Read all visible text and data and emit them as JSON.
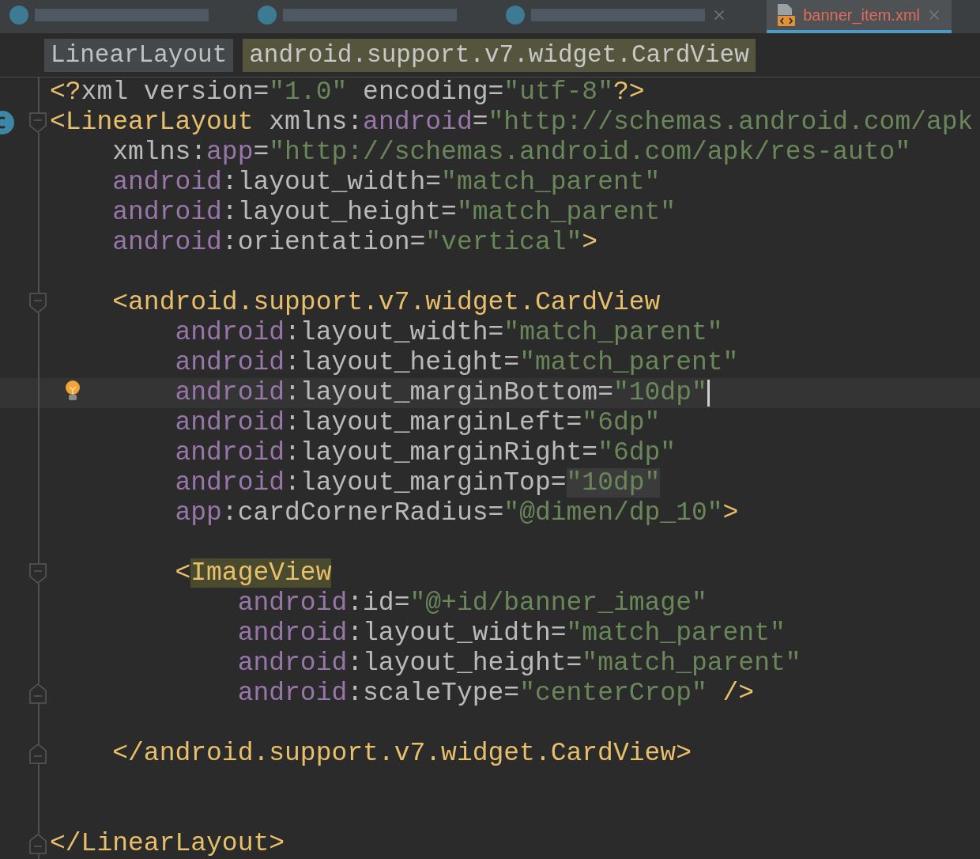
{
  "tabs": [
    {
      "kind": "obscured",
      "selected": false,
      "closable": false
    },
    {
      "kind": "obscured",
      "selected": false,
      "closable": false
    },
    {
      "kind": "obscured",
      "selected": false,
      "closable": true
    },
    {
      "kind": "file",
      "label": "banner_item.xml",
      "selected": true,
      "closable": true
    }
  ],
  "breadcrumbs": [
    {
      "label": "LinearLayout",
      "selected": false
    },
    {
      "label": "android.support.v7.widget.CardView",
      "selected": true
    }
  ],
  "lines": [
    {
      "fold_open": false,
      "fold_close": false,
      "class_marker": false,
      "bulb": false,
      "caret": false,
      "tokens": [
        {
          "kind": "tag",
          "text": "<?"
        },
        {
          "kind": "plain",
          "text": "xml version"
        },
        {
          "kind": "punct",
          "text": "="
        },
        {
          "kind": "str",
          "text": "\"1.0\""
        },
        {
          "kind": "plain",
          "text": " encoding"
        },
        {
          "kind": "punct",
          "text": "="
        },
        {
          "kind": "str",
          "text": "\"utf-8\""
        },
        {
          "kind": "tag",
          "text": "?>"
        }
      ]
    },
    {
      "fold_open": true,
      "fold_close": false,
      "class_marker": true,
      "bulb": false,
      "caret": false,
      "tokens": [
        {
          "kind": "tag",
          "text": "<LinearLayout "
        },
        {
          "kind": "attr",
          "text": "xmlns:"
        },
        {
          "kind": "ns",
          "text": "android"
        },
        {
          "kind": "punct",
          "text": "="
        },
        {
          "kind": "str",
          "text": "\"http://schemas.android.com/apk"
        }
      ]
    },
    {
      "fold_open": false,
      "fold_close": false,
      "class_marker": false,
      "bulb": false,
      "caret": false,
      "tokens": [
        {
          "kind": "attr",
          "text": "    xmlns:"
        },
        {
          "kind": "ns",
          "text": "app"
        },
        {
          "kind": "punct",
          "text": "="
        },
        {
          "kind": "str",
          "text": "\"http://schemas.android.com/apk/res-auto\""
        }
      ]
    },
    {
      "fold_open": false,
      "fold_close": false,
      "class_marker": false,
      "bulb": false,
      "caret": false,
      "tokens": [
        {
          "kind": "ns",
          "text": "    android"
        },
        {
          "kind": "attr",
          "text": ":layout_width"
        },
        {
          "kind": "punct",
          "text": "="
        },
        {
          "kind": "str",
          "text": "\"match_parent\""
        }
      ]
    },
    {
      "fold_open": false,
      "fold_close": false,
      "class_marker": false,
      "bulb": false,
      "caret": false,
      "tokens": [
        {
          "kind": "ns",
          "text": "    android"
        },
        {
          "kind": "attr",
          "text": ":layout_height"
        },
        {
          "kind": "punct",
          "text": "="
        },
        {
          "kind": "str",
          "text": "\"match_parent\""
        }
      ]
    },
    {
      "fold_open": false,
      "fold_close": false,
      "class_marker": false,
      "bulb": false,
      "caret": false,
      "tokens": [
        {
          "kind": "ns",
          "text": "    android"
        },
        {
          "kind": "attr",
          "text": ":orientation"
        },
        {
          "kind": "punct",
          "text": "="
        },
        {
          "kind": "str",
          "text": "\"vertical\""
        },
        {
          "kind": "tag",
          "text": ">"
        }
      ]
    },
    {
      "fold_open": false,
      "fold_close": false,
      "class_marker": false,
      "bulb": false,
      "caret": false
    },
    {
      "fold_open": true,
      "fold_close": false,
      "class_marker": false,
      "bulb": false,
      "caret": false,
      "tokens": [
        {
          "kind": "tag",
          "text": "    <android.support.v7.widget.CardView"
        }
      ]
    },
    {
      "fold_open": false,
      "fold_close": false,
      "class_marker": false,
      "bulb": false,
      "caret": false,
      "tokens": [
        {
          "kind": "ns",
          "text": "        android"
        },
        {
          "kind": "attr",
          "text": ":layout_width"
        },
        {
          "kind": "punct",
          "text": "="
        },
        {
          "kind": "str",
          "text": "\"match_parent\""
        }
      ]
    },
    {
      "fold_open": false,
      "fold_close": false,
      "class_marker": false,
      "bulb": false,
      "caret": false,
      "tokens": [
        {
          "kind": "ns",
          "text": "        android"
        },
        {
          "kind": "attr",
          "text": ":layout_height"
        },
        {
          "kind": "punct",
          "text": "="
        },
        {
          "kind": "str",
          "text": "\"match_parent\""
        }
      ]
    },
    {
      "fold_open": false,
      "fold_close": false,
      "class_marker": false,
      "bulb": true,
      "caret": true,
      "tokens": [
        {
          "kind": "ns",
          "text": "        android"
        },
        {
          "kind": "attr",
          "text": ":layout_marginBottom"
        },
        {
          "kind": "punct",
          "text": "="
        },
        {
          "kind": "str",
          "text": "\"10dp\""
        }
      ]
    },
    {
      "fold_open": false,
      "fold_close": false,
      "class_marker": false,
      "bulb": false,
      "caret": false,
      "tokens": [
        {
          "kind": "ns",
          "text": "        android"
        },
        {
          "kind": "attr",
          "text": ":layout_marginLeft"
        },
        {
          "kind": "punct",
          "text": "="
        },
        {
          "kind": "str",
          "text": "\"6dp\""
        }
      ]
    },
    {
      "fold_open": false,
      "fold_close": false,
      "class_marker": false,
      "bulb": false,
      "caret": false,
      "tokens": [
        {
          "kind": "ns",
          "text": "        android"
        },
        {
          "kind": "attr",
          "text": ":layout_marginRight"
        },
        {
          "kind": "punct",
          "text": "="
        },
        {
          "kind": "str",
          "text": "\"6dp\""
        }
      ]
    },
    {
      "fold_open": false,
      "fold_close": false,
      "class_marker": false,
      "bulb": false,
      "caret": false,
      "tokens": [
        {
          "kind": "ns",
          "text": "        android"
        },
        {
          "kind": "attr",
          "text": ":layout_marginTop"
        },
        {
          "kind": "punct",
          "text": "="
        },
        {
          "kind": "str-match",
          "text": "\"10dp\""
        }
      ]
    },
    {
      "fold_open": false,
      "fold_close": false,
      "class_marker": false,
      "bulb": false,
      "caret": false,
      "tokens": [
        {
          "kind": "ns",
          "text": "        app"
        },
        {
          "kind": "attr",
          "text": ":cardCornerRadius"
        },
        {
          "kind": "punct",
          "text": "="
        },
        {
          "kind": "str",
          "text": "\"@dimen/dp_10\""
        },
        {
          "kind": "tag",
          "text": ">"
        }
      ]
    },
    {
      "fold_open": false,
      "fold_close": false,
      "class_marker": false,
      "bulb": false,
      "caret": false
    },
    {
      "fold_open": true,
      "fold_close": false,
      "class_marker": false,
      "bulb": false,
      "caret": false,
      "tokens": [
        {
          "kind": "tag",
          "text": "        <"
        },
        {
          "kind": "tag-match",
          "text": "ImageView"
        }
      ]
    },
    {
      "fold_open": false,
      "fold_close": false,
      "class_marker": false,
      "bulb": false,
      "caret": false,
      "tokens": [
        {
          "kind": "ns",
          "text": "            android"
        },
        {
          "kind": "attr",
          "text": ":id"
        },
        {
          "kind": "punct",
          "text": "="
        },
        {
          "kind": "str",
          "text": "\"@+id/banner_image\""
        }
      ]
    },
    {
      "fold_open": false,
      "fold_close": false,
      "class_marker": false,
      "bulb": false,
      "caret": false,
      "tokens": [
        {
          "kind": "ns",
          "text": "            android"
        },
        {
          "kind": "attr",
          "text": ":layout_width"
        },
        {
          "kind": "punct",
          "text": "="
        },
        {
          "kind": "str",
          "text": "\"match_parent\""
        }
      ]
    },
    {
      "fold_open": false,
      "fold_close": false,
      "class_marker": false,
      "bulb": false,
      "caret": false,
      "tokens": [
        {
          "kind": "ns",
          "text": "            android"
        },
        {
          "kind": "attr",
          "text": ":layout_height"
        },
        {
          "kind": "punct",
          "text": "="
        },
        {
          "kind": "str",
          "text": "\"match_parent\""
        }
      ]
    },
    {
      "fold_open": false,
      "fold_close": true,
      "class_marker": false,
      "bulb": false,
      "caret": false,
      "tokens": [
        {
          "kind": "ns",
          "text": "            android"
        },
        {
          "kind": "attr",
          "text": ":scaleType"
        },
        {
          "kind": "punct",
          "text": "="
        },
        {
          "kind": "str",
          "text": "\"centerCrop\""
        },
        {
          "kind": "tag",
          "text": " />"
        }
      ]
    },
    {
      "fold_open": false,
      "fold_close": false,
      "class_marker": false,
      "bulb": false,
      "caret": false
    },
    {
      "fold_open": false,
      "fold_close": true,
      "class_marker": false,
      "bulb": false,
      "caret": false,
      "tokens": [
        {
          "kind": "tag",
          "text": "    </android.support.v7.widget.CardView>"
        }
      ]
    },
    {
      "fold_open": false,
      "fold_close": false,
      "class_marker": false,
      "bulb": false,
      "caret": false
    },
    {
      "fold_open": false,
      "fold_close": false,
      "class_marker": false,
      "bulb": false,
      "caret": false
    },
    {
      "fold_open": false,
      "fold_close": true,
      "class_marker": false,
      "bulb": false,
      "caret": false,
      "tokens": [
        {
          "kind": "tag",
          "text": "</LinearLayout>"
        }
      ]
    }
  ]
}
